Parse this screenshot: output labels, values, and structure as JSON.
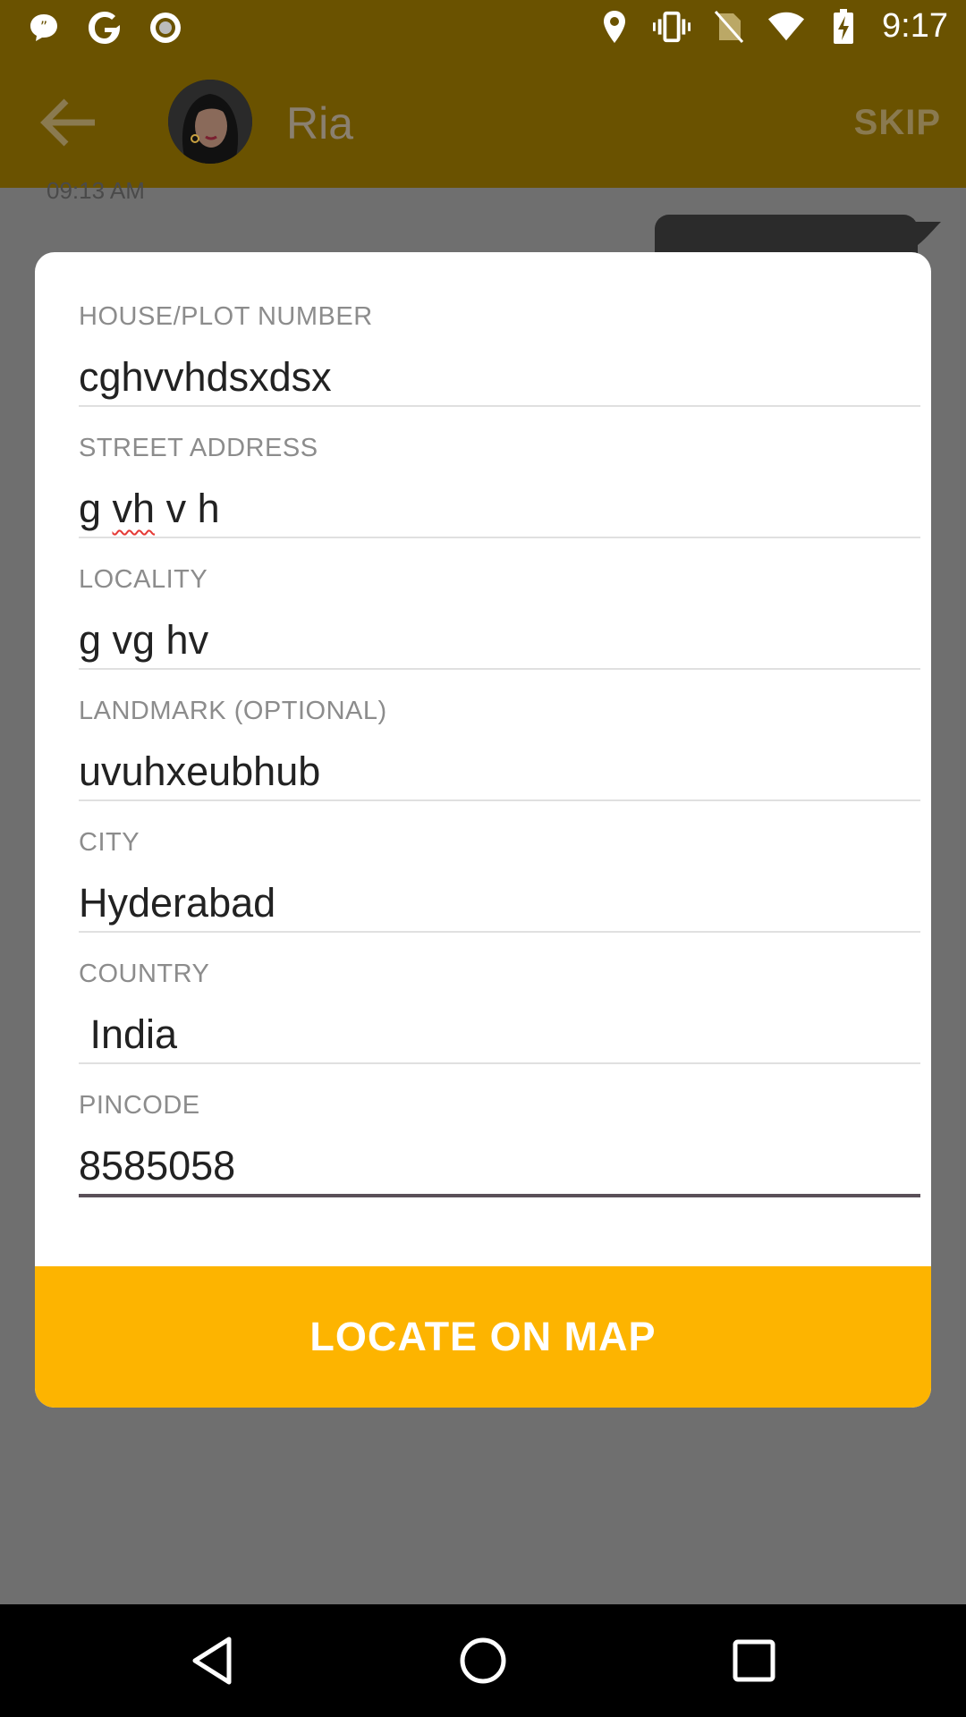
{
  "status_bar": {
    "time": "9:17",
    "left_icons": [
      "message-bubble-icon",
      "google-icon",
      "record-icon"
    ],
    "right_icons": [
      "location-pin-icon",
      "vibrate-icon",
      "no-sim-icon",
      "wifi-icon",
      "battery-charging-icon"
    ]
  },
  "app_bar": {
    "contact_name": "Ria",
    "skip_label": "SKIP"
  },
  "chat": {
    "timestamp": "09:13 AM"
  },
  "form": {
    "fields": [
      {
        "label": "HOUSE/PLOT NUMBER",
        "value": "cghvvhdsxdsx"
      },
      {
        "label": "STREET ADDRESS",
        "value_pre": "g ",
        "value_misspelled": "vh",
        "value_post": " v h"
      },
      {
        "label": "LOCALITY",
        "value": "g vg hv"
      },
      {
        "label": "LANDMARK (OPTIONAL)",
        "value": "uvuhxeubhub"
      },
      {
        "label": "CITY",
        "value": "Hyderabad"
      },
      {
        "label": "COUNTRY",
        "value": " India"
      },
      {
        "label": "PINCODE",
        "value": "8585058"
      }
    ],
    "locate_label": "LOCATE ON MAP"
  },
  "colors": {
    "app_bar": "#6a5200",
    "accent": "#fdb400"
  }
}
